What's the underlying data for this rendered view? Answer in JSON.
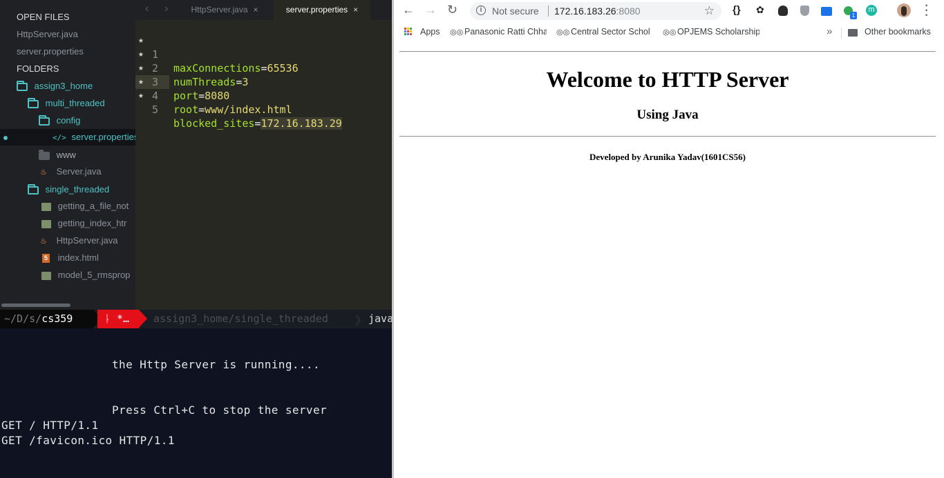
{
  "sidebar": {
    "open_files_heading": "OPEN FILES",
    "open_files": [
      "HttpServer.java",
      "server.properties"
    ],
    "folders_heading": "FOLDERS",
    "tree": {
      "root": "assign3_home",
      "multi_threaded": "multi_threaded",
      "config": "config",
      "server_properties": "server.properties",
      "www": "www",
      "server_java": "Server.java",
      "single_threaded": "single_threaded",
      "getting_a_file": "getting_a_file_not",
      "getting_index": "getting_index_htr",
      "http_server_java": "HttpServer.java",
      "index_html": "index.html",
      "model_5": "model_5_rmsprop"
    }
  },
  "editor": {
    "tabs": [
      {
        "label": "HttpServer.java",
        "close": "×"
      },
      {
        "label": "server.properties",
        "close": "×"
      }
    ],
    "active_tab": 1,
    "lines": [
      {
        "num": "1",
        "mark": "★",
        "key": "maxConnections",
        "eq": "=",
        "value": "65536"
      },
      {
        "num": "2",
        "mark": "★",
        "key": "numThreads",
        "eq": "=",
        "value": "3"
      },
      {
        "num": "3",
        "mark": "★",
        "key": "port",
        "eq": "=",
        "value": "8080"
      },
      {
        "num": "4",
        "mark": "★",
        "key": "root",
        "eq": "=",
        "value": "www/index.html"
      },
      {
        "num": "5",
        "mark": "★",
        "key": "blocked_sites",
        "eq": "=",
        "value": "172.16.183.29"
      }
    ]
  },
  "terminal": {
    "prompt_path_prefix": "~/D/s/",
    "prompt_path_dir": "cs359",
    "prompt_git": "ᚿ *…",
    "prompt_cwd": "assign3_home/single_threaded",
    "prompt_cmd": "java",
    "output": [
      "the Http Server is running....",
      "Press Ctrl+C to stop the server",
      "GET / HTTP/1.1",
      "GET /favicon.ico HTTP/1.1"
    ]
  },
  "browser": {
    "security_label": "Not secure",
    "url_host": "172.16.183.26",
    "url_port": ":8080",
    "ext_braces": "{}",
    "ext_badge_count": "1",
    "ext_m_letter": "m",
    "bookmarks": [
      {
        "label": "Apps"
      },
      {
        "label": "Panasonic Ratti Chha"
      },
      {
        "label": "Central Sector Schol"
      },
      {
        "label": "OPJEMS Scholarship"
      }
    ],
    "more_label": "»",
    "other_bookmarks": "Other bookmarks",
    "page": {
      "heading": "Welcome to HTTP Server",
      "subheading": "Using Java",
      "developer": "Developed by Arunika Yadav(1601CS56)"
    }
  },
  "colors": {
    "editor_bg": "#272822",
    "keyword": "#a6e22e",
    "string": "#e6db74",
    "terminal_bg": "#0f1220",
    "git_segment": "#e3101a",
    "accent_teal": "#4ec3c4"
  }
}
